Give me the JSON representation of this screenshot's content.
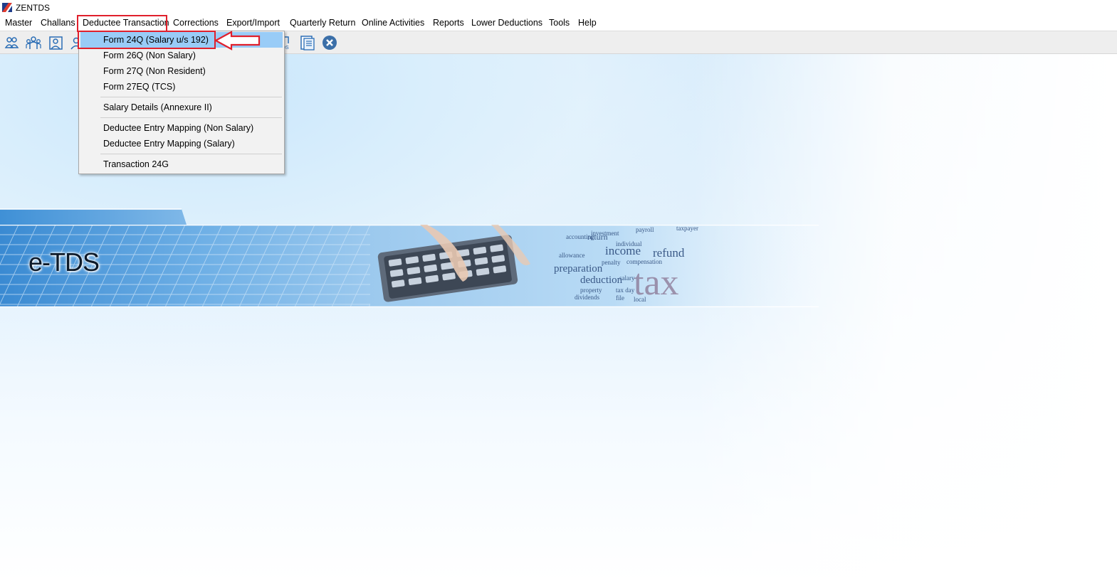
{
  "window": {
    "title": "ZENTDS"
  },
  "menubar": {
    "items": [
      {
        "label": "Master"
      },
      {
        "label": "Challans"
      },
      {
        "label": "Deductee Transaction"
      },
      {
        "label": "Corrections"
      },
      {
        "label": "Export/Import"
      },
      {
        "label": "Quarterly Return"
      },
      {
        "label": "Online Activities"
      },
      {
        "label": "Reports"
      },
      {
        "label": "Lower Deductions"
      },
      {
        "label": "Tools"
      },
      {
        "label": "Help"
      }
    ]
  },
  "dropdown": {
    "items": [
      {
        "label": "Form 24Q (Salary u/s 192)",
        "selected": true
      },
      {
        "label": "Form 26Q (Non Salary)"
      },
      {
        "label": "Form 27Q (Non Resident)"
      },
      {
        "label": "Form 27EQ (TCS)"
      },
      {
        "label": "Salary Details (Annexure II)"
      },
      {
        "label": "Deductee Entry Mapping (Non Salary)"
      },
      {
        "label": "Deductee Entry Mapping (Salary)"
      },
      {
        "label": "Transaction 24G"
      }
    ]
  },
  "toolbar": {
    "icons": [
      "deductor-icon",
      "group-icon",
      "user-card-icon",
      "user-icon",
      "ts-icon",
      "register-icon",
      "close-circle-icon"
    ]
  },
  "banner": {
    "text": "e-TDS",
    "words": [
      "payroll",
      "taxpayer",
      "investment",
      "accounting",
      "individual",
      "income",
      "refund",
      "penalty",
      "compensation",
      "preparation",
      "deduction",
      "return",
      "allowance",
      "salary",
      "property",
      "tax day",
      "dividends",
      "file",
      "local",
      "tax"
    ]
  },
  "colors": {
    "menu_highlight": "#99ccf7",
    "annotation": "#e0202c",
    "desktop_bg": "#d9eefc"
  }
}
